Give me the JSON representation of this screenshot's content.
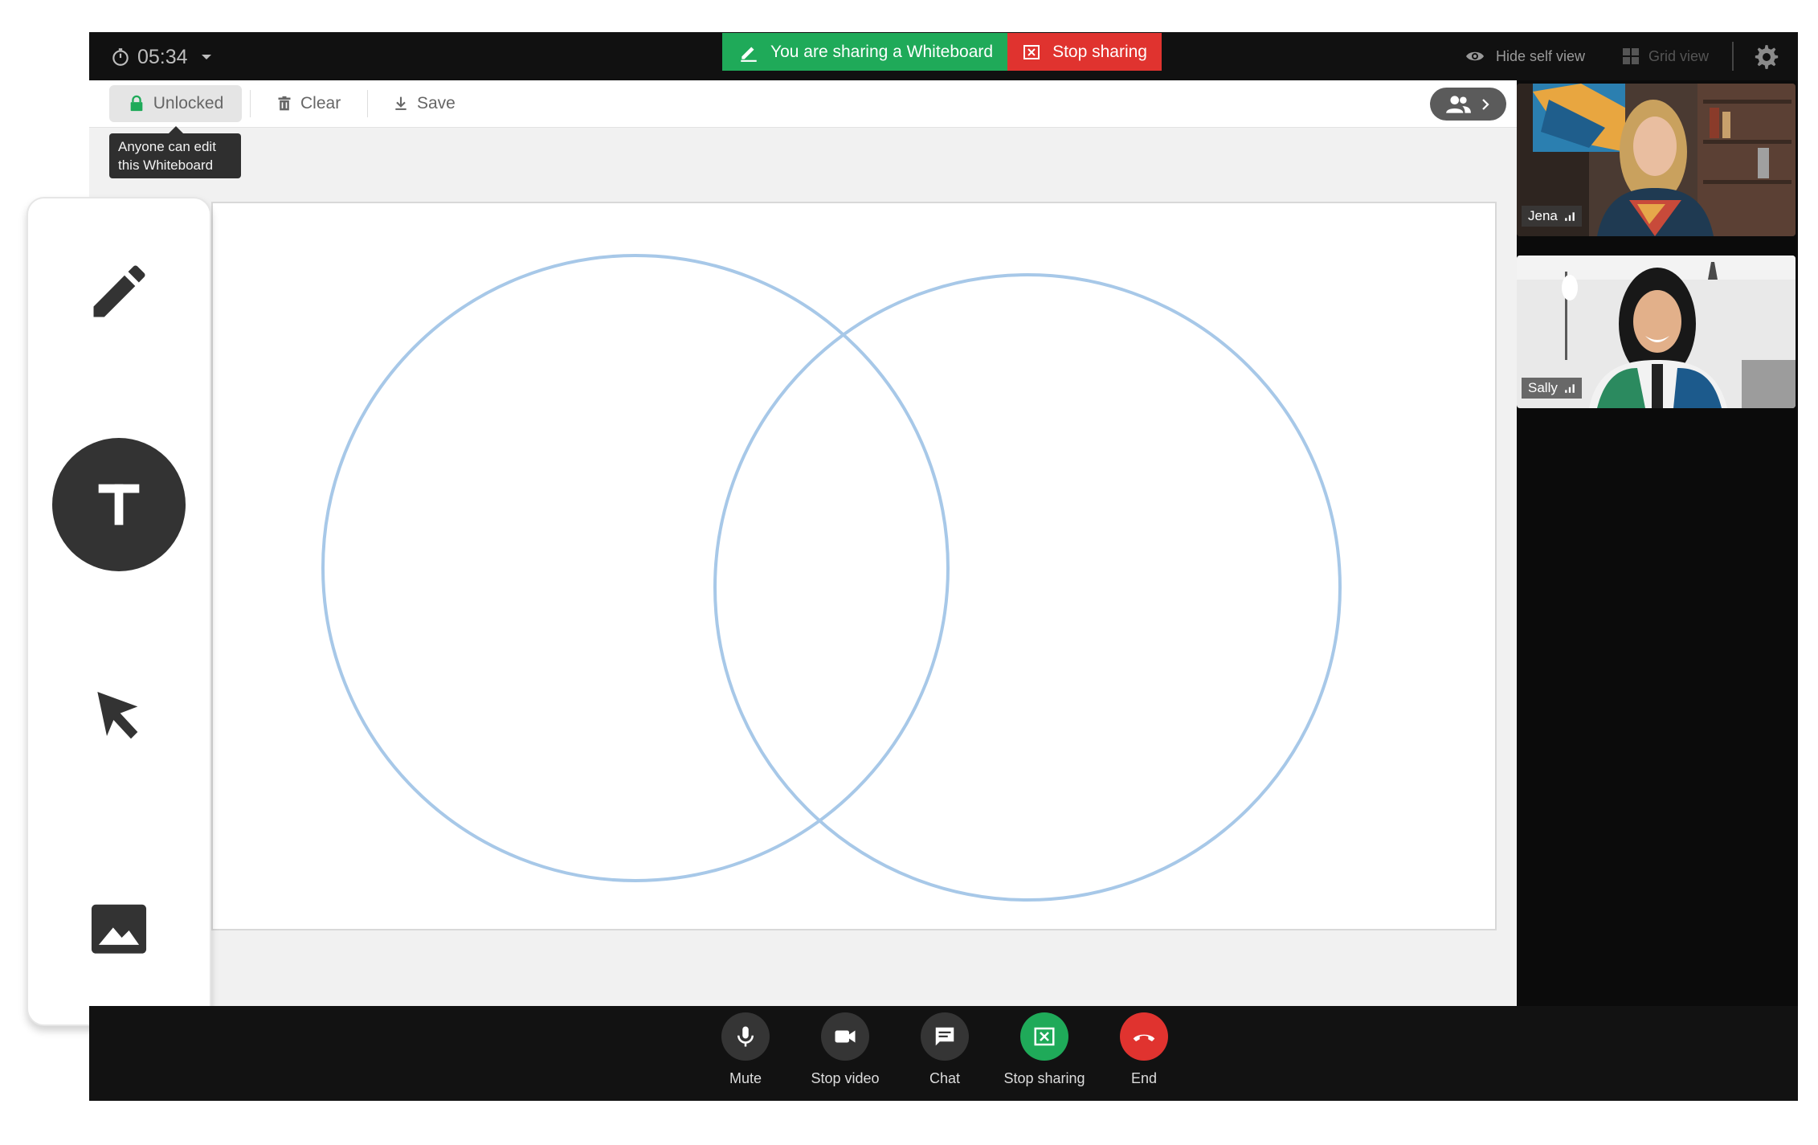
{
  "timer": {
    "value": "05:34"
  },
  "sharing": {
    "banner": "You are sharing a Whiteboard",
    "stop": "Stop sharing"
  },
  "view": {
    "hide_self": "Hide self view",
    "grid": "Grid view"
  },
  "toolbar": {
    "unlocked": "Unlocked",
    "clear": "Clear",
    "save": "Save"
  },
  "tooltip": {
    "line1": "Anyone can edit",
    "line2": "this Whiteboard"
  },
  "participants": [
    {
      "name": "Jena"
    },
    {
      "name": "Sally"
    }
  ],
  "controls": {
    "mute": "Mute",
    "stop_video": "Stop video",
    "chat": "Chat",
    "stop_sharing": "Stop sharing",
    "end": "End"
  },
  "colors": {
    "green": "#1faa59",
    "red": "#e0332f",
    "circle": "#a7c8e8"
  },
  "tools": [
    "pencil-icon",
    "text-icon",
    "pointer-icon",
    "image-icon"
  ]
}
